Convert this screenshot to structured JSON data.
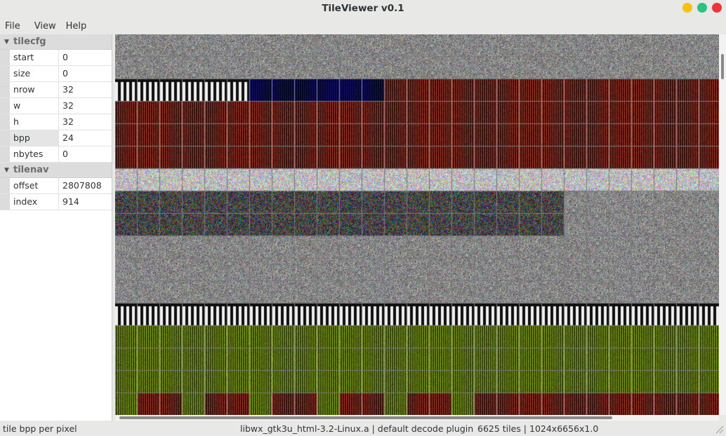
{
  "window": {
    "title": "TileViewer v0.1",
    "buttons": [
      {
        "name": "minimize",
        "color": "#f5c211"
      },
      {
        "name": "maximize",
        "color": "#2ec27e"
      },
      {
        "name": "close",
        "color": "#ed333b"
      }
    ]
  },
  "menu": [
    "File",
    "View",
    "Help"
  ],
  "sidebar": {
    "groups": [
      {
        "label": "tilecfg",
        "rows": [
          {
            "name": "start",
            "value": "0"
          },
          {
            "name": "size",
            "value": "0"
          },
          {
            "name": "nrow",
            "value": "32"
          },
          {
            "name": "w",
            "value": "32"
          },
          {
            "name": "h",
            "value": "32"
          },
          {
            "name": "bpp",
            "value": "24"
          },
          {
            "name": "nbytes",
            "value": "0"
          }
        ]
      },
      {
        "label": "tilenav",
        "rows": [
          {
            "name": "offset",
            "value": "2807808"
          },
          {
            "name": "index",
            "value": "914"
          }
        ]
      }
    ]
  },
  "status": {
    "hint": "tile bpp per pixel",
    "plugin": "libwx_gtk3u_html-3.2-Linux.a | default decode plugin",
    "info": "6625 tiles | 1024x6656x1.0"
  },
  "colors": {
    "noise": "#787878",
    "dark_red": "#3a1410",
    "dark_green": "#1a2a10",
    "dark_blue": "#10104a",
    "olive": "#3a4a10",
    "stripe_white": "#f0f0f0"
  }
}
